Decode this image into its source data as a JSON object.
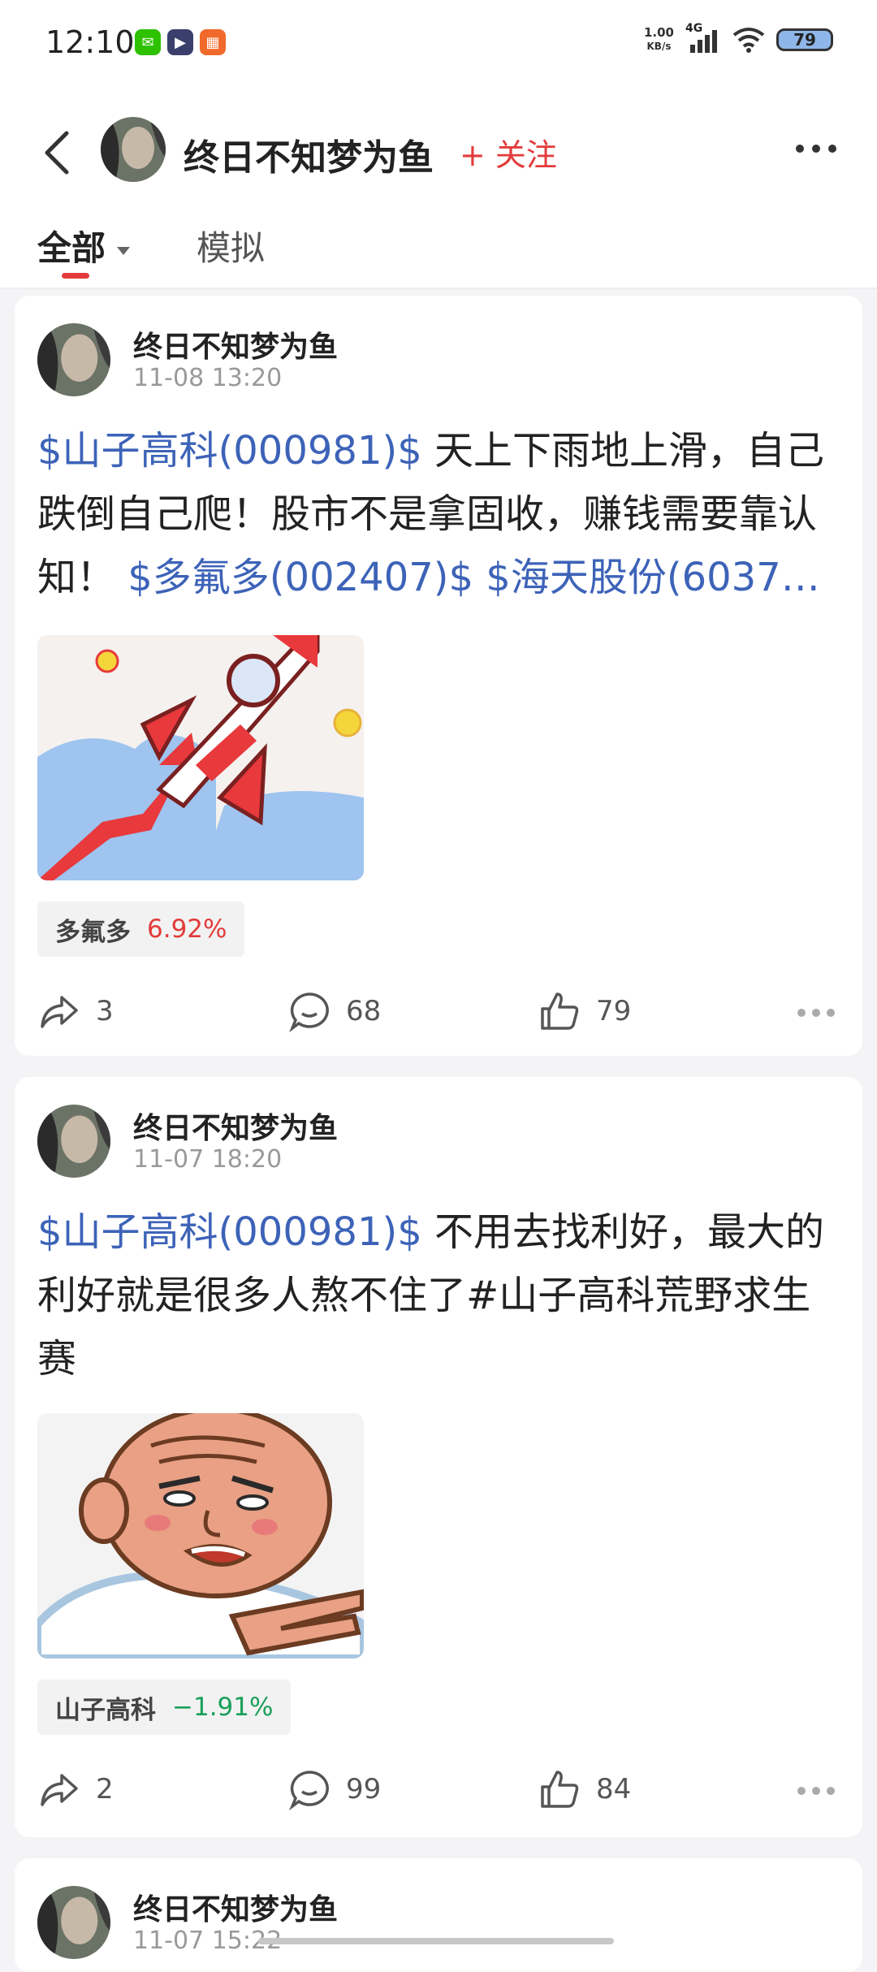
{
  "status_bar": {
    "time": "12:10",
    "net_speed_value": "1.00",
    "net_speed_unit": "KB/s",
    "network": "4G",
    "battery": "79"
  },
  "header": {
    "username": "终日不知梦为鱼",
    "follow_label": "+ 关注"
  },
  "tabs": [
    {
      "label": "全部",
      "active": true
    },
    {
      "label": "模拟",
      "active": false
    }
  ],
  "posts": [
    {
      "author": "终日不知梦为鱼",
      "time": "11-08 13:20",
      "stock1": "$山子高科(000981)$",
      "text1": " 天上下雨地上滑，自己跌倒自己爬！股市不是拿固收，赚钱需要靠认知！ ",
      "stock2": "$多氟多(002407)$",
      "stock3": " $海天股份(6037…",
      "image_icon": "rocket-illustration",
      "tag_name": "多氟多",
      "tag_change": "6.92%",
      "shares": "3",
      "comments": "68",
      "likes": "79"
    },
    {
      "author": "终日不知梦为鱼",
      "time": "11-07 18:20",
      "stock1": "$山子高科(000981)$",
      "text1": " 不用去找利好，最大的利好就是很多人熬不住了#山子高科荒野求生赛",
      "image_icon": "old-man-meme-illustration",
      "tag_name": "山子高科",
      "tag_change": "−1.91%",
      "shares": "2",
      "comments": "99",
      "likes": "84"
    },
    {
      "author": "终日不知梦为鱼",
      "time": "11-07 15:22"
    }
  ],
  "colors": {
    "accent_red": "#e33b3b",
    "stock_blue": "#3d63b8",
    "down_green": "#1aa05a"
  }
}
